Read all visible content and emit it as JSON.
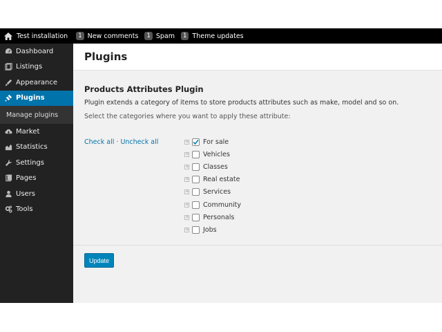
{
  "topbar": {
    "site_name": "Test installation",
    "items": [
      {
        "count": "1",
        "label": "New comments"
      },
      {
        "count": "1",
        "label": "Spam"
      },
      {
        "count": "1",
        "label": "Theme updates"
      }
    ]
  },
  "sidebar": {
    "items": [
      {
        "label": "Dashboard",
        "icon": "dashboard-icon"
      },
      {
        "label": "Listings",
        "icon": "listings-icon"
      },
      {
        "label": "Appearance",
        "icon": "appearance-icon"
      },
      {
        "label": "Plugins",
        "icon": "plugins-icon",
        "active": true
      },
      {
        "label": "Market",
        "icon": "market-icon"
      },
      {
        "label": "Statistics",
        "icon": "statistics-icon"
      },
      {
        "label": "Settings",
        "icon": "settings-icon"
      },
      {
        "label": "Pages",
        "icon": "pages-icon"
      },
      {
        "label": "Users",
        "icon": "users-icon"
      },
      {
        "label": "Tools",
        "icon": "tools-icon"
      }
    ],
    "submenu_label": "Manage plugins"
  },
  "page": {
    "title": "Plugins",
    "plugin_title": "Products Attributes Plugin",
    "description": "Plugin extends a category of items to store products attributes such as make, model and so on.",
    "instruction": "Select the categories where you want to apply these attribute:",
    "check_all": "Check all",
    "separator": "·",
    "uncheck_all": "Uncheck all",
    "categories": [
      {
        "label": "For sale",
        "checked": true
      },
      {
        "label": "Vehicles",
        "checked": false
      },
      {
        "label": "Classes",
        "checked": false
      },
      {
        "label": "Real estate",
        "checked": false
      },
      {
        "label": "Services",
        "checked": false
      },
      {
        "label": "Community",
        "checked": false
      },
      {
        "label": "Personals",
        "checked": false
      },
      {
        "label": "Jobs",
        "checked": false
      }
    ],
    "update_label": "Update"
  },
  "colors": {
    "accent": "#0073aa",
    "button": "#0085ba",
    "sidebar_bg": "#222222",
    "topbar_bg": "#000000"
  }
}
